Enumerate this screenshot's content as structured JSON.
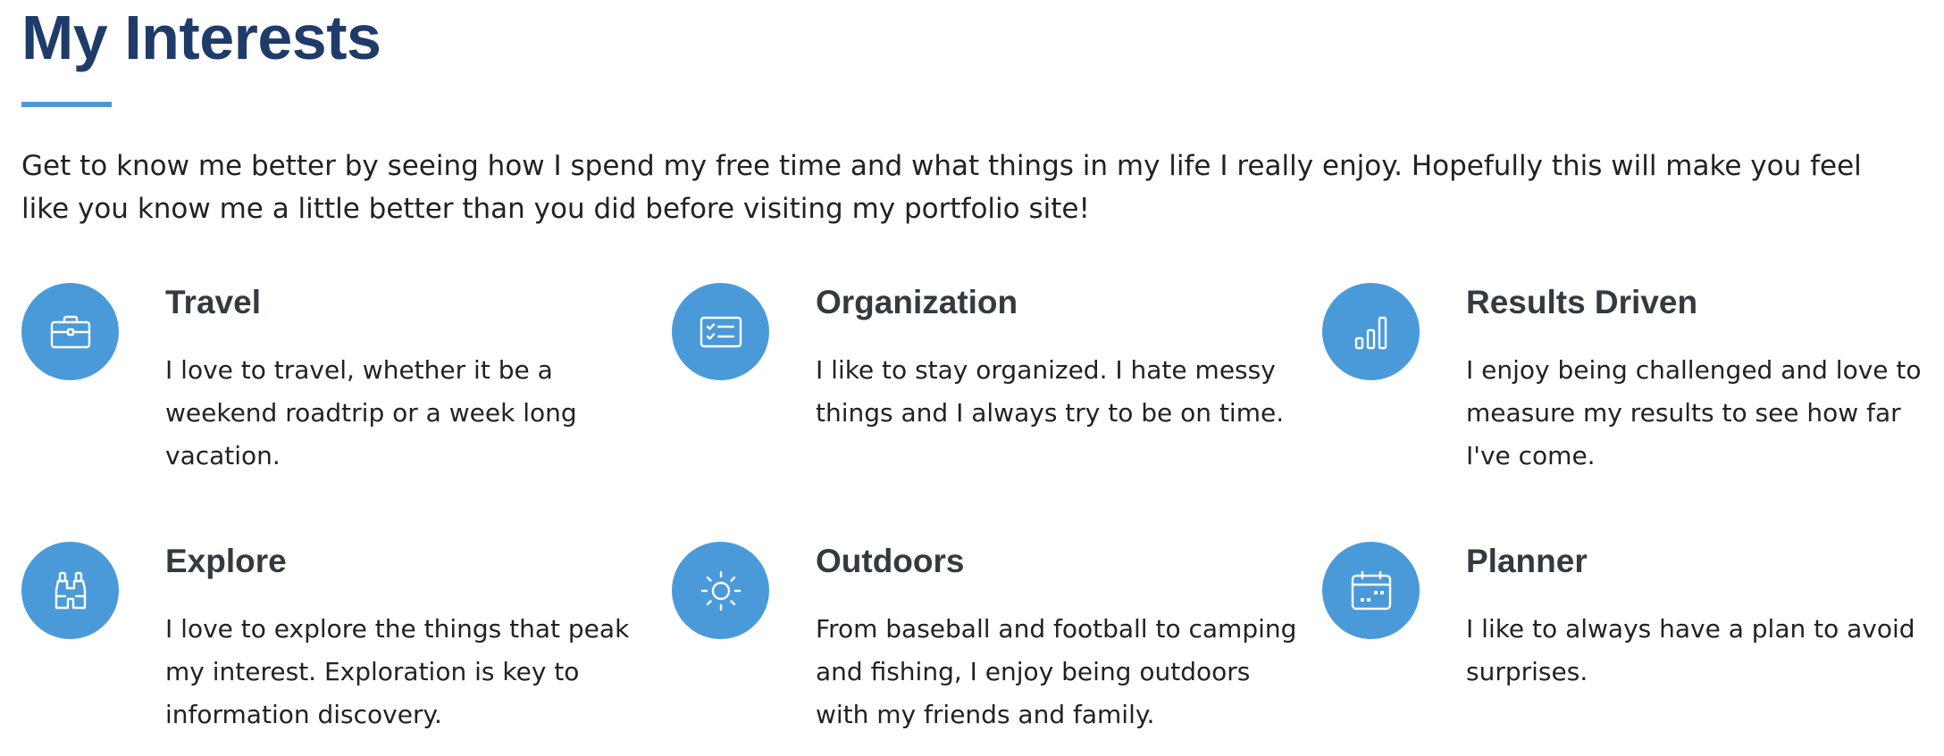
{
  "section": {
    "title": "My Interests",
    "intro": "Get to know me better by seeing how I spend my free time and what things in my life I really enjoy. Hopefully this will make you feel like you know me a little better than you did before visiting my portfolio site!"
  },
  "colors": {
    "title": "#1f3b69",
    "accent": "#4a9ad9",
    "heading": "#333a40",
    "text": "#222222"
  },
  "interests": [
    {
      "icon": "briefcase-icon",
      "title": "Travel",
      "description": "I love to travel, whether it be a weekend roadtrip or a week long vacation."
    },
    {
      "icon": "checklist-card-icon",
      "title": "Organization",
      "description": "I like to stay organized. I hate messy things and I always try to be on time."
    },
    {
      "icon": "bar-chart-icon",
      "title": "Results Driven",
      "description": "I enjoy being challenged and love to measure my results to see how far I've come."
    },
    {
      "icon": "binoculars-icon",
      "title": "Explore",
      "description": "I love to explore the things that peak my interest. Exploration is key to information discovery."
    },
    {
      "icon": "sun-icon",
      "title": "Outdoors",
      "description": "From baseball and football to camping and fishing, I enjoy being outdoors with my friends and family."
    },
    {
      "icon": "calendar-icon",
      "title": "Planner",
      "description": "I like to always have a plan to avoid surprises."
    }
  ]
}
